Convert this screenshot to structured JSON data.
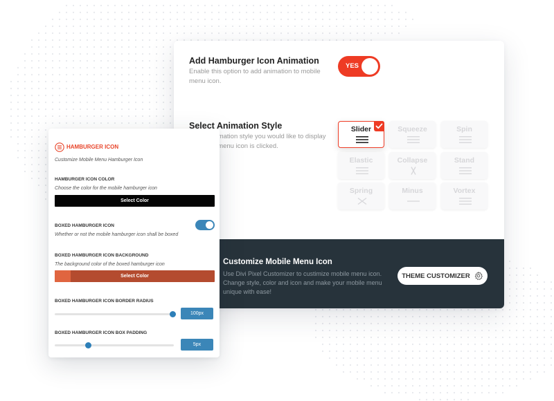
{
  "animation_section": {
    "title": "Add Hamburger Icon Animation",
    "description": "Enable this option to add animation to mobile menu icon.",
    "toggle": {
      "label": "YES",
      "enabled": true,
      "color": "#ee3b24"
    }
  },
  "style_section": {
    "title": "Select Animation Style",
    "description": "Select animation style you would like to display when the menu icon is clicked.",
    "selected": "Slider",
    "styles": [
      {
        "label": "Slider",
        "icon": "hamburger-icon",
        "selected": true
      },
      {
        "label": "Squeeze",
        "icon": "hamburger-icon",
        "selected": false
      },
      {
        "label": "Spin",
        "icon": "hamburger-icon",
        "selected": false
      },
      {
        "label": "Elastic",
        "icon": "hamburger-icon",
        "selected": false
      },
      {
        "label": "Collapse",
        "icon": "x-icon",
        "selected": false
      },
      {
        "label": "Stand",
        "icon": "hamburger-icon",
        "selected": false
      },
      {
        "label": "Spring",
        "icon": "x-icon",
        "selected": false
      },
      {
        "label": "Minus",
        "icon": "minus-icon",
        "selected": false
      },
      {
        "label": "Vortex",
        "icon": "hamburger-icon",
        "selected": false
      }
    ]
  },
  "footer": {
    "title": "Customize Mobile Menu Icon",
    "description": "Use Divi Pixel Customizer to custimize mobile menu icon. Change style, color and icon and make your mobile menu unique with ease!",
    "button_label": "THEME CUSTOMIZER",
    "button_icon": "gear-icon",
    "background": "#27333b"
  },
  "panel": {
    "header_icon": "hamburger-circle-icon",
    "header": "HAMBURGER ICON",
    "subtitle": "Customize Mobile Menu Hamburger Icon",
    "icon_color": {
      "label": "HAMBURGER ICON COLOR",
      "description": "Choose the color for the mobile hamburger icon",
      "button_label": "Select Color",
      "value": "#000000"
    },
    "boxed": {
      "label": "BOXED HAMBURGER ICON",
      "description": "Whether or not the mobile hamburger icon shall be boxed",
      "enabled": true
    },
    "box_background": {
      "label": "BOXED HAMBURGER ICON BACKGROUND",
      "description": "The background color of the boxed hamburger icon",
      "button_label": "Select Color",
      "value": "#e06540"
    },
    "border_radius": {
      "label": "BOXED HAMBURGER ICON BORDER RADIUS",
      "value": "100px",
      "fraction": 1.0
    },
    "box_padding": {
      "label": "BOXED HAMBURGER ICON BOX PADDING",
      "value": "5px",
      "fraction": 0.25
    }
  },
  "colors": {
    "accent": "#ee3b24",
    "panel_blue": "#3b86b8",
    "dark": "#27333b"
  }
}
